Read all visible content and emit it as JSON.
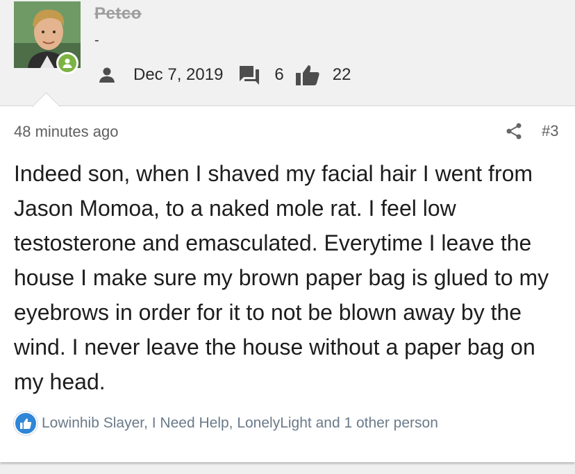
{
  "user": {
    "name": "Petco",
    "title": "-"
  },
  "stats": {
    "join_date": "Dec 7, 2019",
    "messages": "6",
    "reactions": "22"
  },
  "post": {
    "timestamp": "48 minutes ago",
    "number": "#3",
    "body": "Indeed son, when I shaved my facial hair I went from Jason Momoa, to a naked mole rat. I feel low testosterone and emasculated. Everytime I leave the house I make sure my brown paper bag is glued to my eyebrows in order for it to not be blown away by the wind. I never leave the house without a paper bag on my head.",
    "reactions_summary": "Lowinhib Slayer, I Need Help, LonelyLight and 1 other person"
  },
  "icons": {
    "online_status": "online-status-icon",
    "user": "user-icon",
    "messages": "messages-icon",
    "reactions": "thumbs-up-icon",
    "share": "share-icon",
    "like_reaction": "like-reaction-icon"
  },
  "colors": {
    "online": "#7cb342",
    "like": "#2f86d6",
    "reactions_text": "#6a7a8a"
  }
}
